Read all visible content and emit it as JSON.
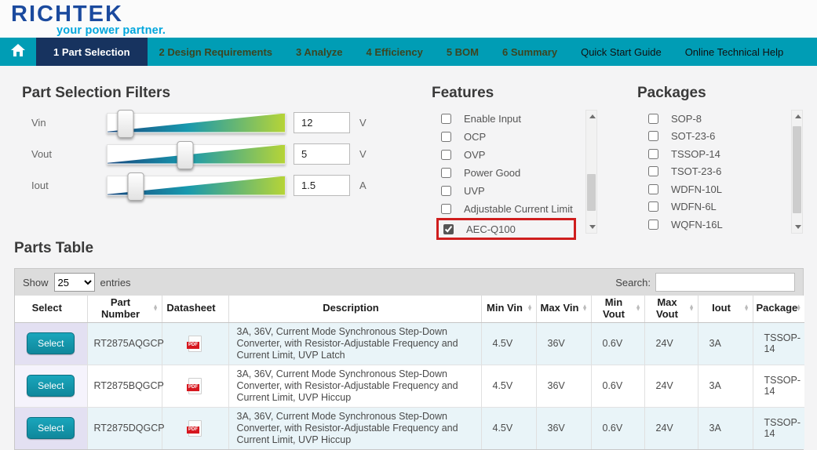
{
  "brand": {
    "name": "RICHTEK",
    "tagline": "your power partner."
  },
  "nav": {
    "items": [
      {
        "label": "1 Part Selection",
        "active": true
      },
      {
        "label": "2 Design Requirements"
      },
      {
        "label": "3 Analyze"
      },
      {
        "label": "4 Efficiency"
      },
      {
        "label": "5 BOM"
      },
      {
        "label": "6 Summary"
      },
      {
        "label": "Quick Start Guide"
      },
      {
        "label": "Online Technical Help"
      }
    ]
  },
  "filters": {
    "title": "Part Selection Filters",
    "sliders": [
      {
        "label": "Vin",
        "value": "12",
        "unit": "V",
        "position_pct": 10
      },
      {
        "label": "Vout",
        "value": "5",
        "unit": "V",
        "position_pct": 44
      },
      {
        "label": "Iout",
        "value": "1.5",
        "unit": "A",
        "position_pct": 16
      }
    ]
  },
  "features": {
    "title": "Features",
    "items": [
      {
        "label": "Enable Input"
      },
      {
        "label": "OCP"
      },
      {
        "label": "OVP"
      },
      {
        "label": "Power Good"
      },
      {
        "label": "UVP"
      },
      {
        "label": "Adjustable Current Limit"
      },
      {
        "label": "AEC-Q100",
        "checked": "checked",
        "highlighted": true
      }
    ]
  },
  "packages": {
    "title": "Packages",
    "items": [
      {
        "label": "SOP-8"
      },
      {
        "label": "SOT-23-6"
      },
      {
        "label": "TSSOP-14"
      },
      {
        "label": "TSOT-23-6"
      },
      {
        "label": "WDFN-10L"
      },
      {
        "label": "WDFN-6L"
      },
      {
        "label": "WQFN-16L"
      }
    ]
  },
  "parts_table": {
    "title": "Parts Table",
    "toolbar": {
      "show_label": "Show",
      "entries_value": "25",
      "entries_suffix": "entries",
      "search_label": "Search:"
    },
    "pdf_label": "PDF",
    "columns": [
      {
        "label": "Select",
        "sortable": false
      },
      {
        "label": "Part Number",
        "sortable": true
      },
      {
        "label": "Datasheet",
        "sortable": false
      },
      {
        "label": "Description",
        "sortable": false
      },
      {
        "label": "Min Vin",
        "sortable": true
      },
      {
        "label": "Max Vin",
        "sortable": true
      },
      {
        "label": "Min Vout",
        "sortable": true
      },
      {
        "label": "Max Vout",
        "sortable": true
      },
      {
        "label": "Iout",
        "sortable": true
      },
      {
        "label": "Package",
        "sortable": true
      }
    ],
    "rows": [
      {
        "select_label": "Select",
        "part_number": "RT2875AQGCP",
        "description": "3A, 36V, Current Mode Synchronous Step-Down Converter, with Resistor-Adjustable Frequency and Current Limit, UVP Latch",
        "min_vin": "4.5V",
        "max_vin": "36V",
        "min_vout": "0.6V",
        "max_vout": "24V",
        "iout": "3A",
        "package": "TSSOP-14"
      },
      {
        "select_label": "Select",
        "part_number": "RT2875BQGCP",
        "description": "3A, 36V, Current Mode Synchronous Step-Down Converter, with Resistor-Adjustable Frequency and Current Limit, UVP Hiccup",
        "min_vin": "4.5V",
        "max_vin": "36V",
        "min_vout": "0.6V",
        "max_vout": "24V",
        "iout": "3A",
        "package": "TSSOP-14"
      },
      {
        "select_label": "Select",
        "part_number": "RT2875DQGCP",
        "description": "3A, 36V, Current Mode Synchronous Step-Down Converter, with Resistor-Adjustable Frequency and Current Limit, UVP Hiccup",
        "min_vin": "4.5V",
        "max_vin": "36V",
        "min_vout": "0.6V",
        "max_vout": "24V",
        "iout": "3A",
        "package": "TSSOP-14"
      }
    ]
  },
  "colors": {
    "nav_teal": "#009db5",
    "active_tab_navy": "#17335f",
    "logo_blue": "#1b4a9e",
    "tagline_cyan": "#00a6dd",
    "slider_gradient_start": "#17477e",
    "slider_gradient_mid": "#1899ae",
    "slider_gradient_end": "#b6d437",
    "highlight_red": "#cf1e1e",
    "select_button_teal": "#13a0b6",
    "row_alt_blue": "#e9f4f8",
    "sorted_column_lavender": "#e3e0f2"
  }
}
